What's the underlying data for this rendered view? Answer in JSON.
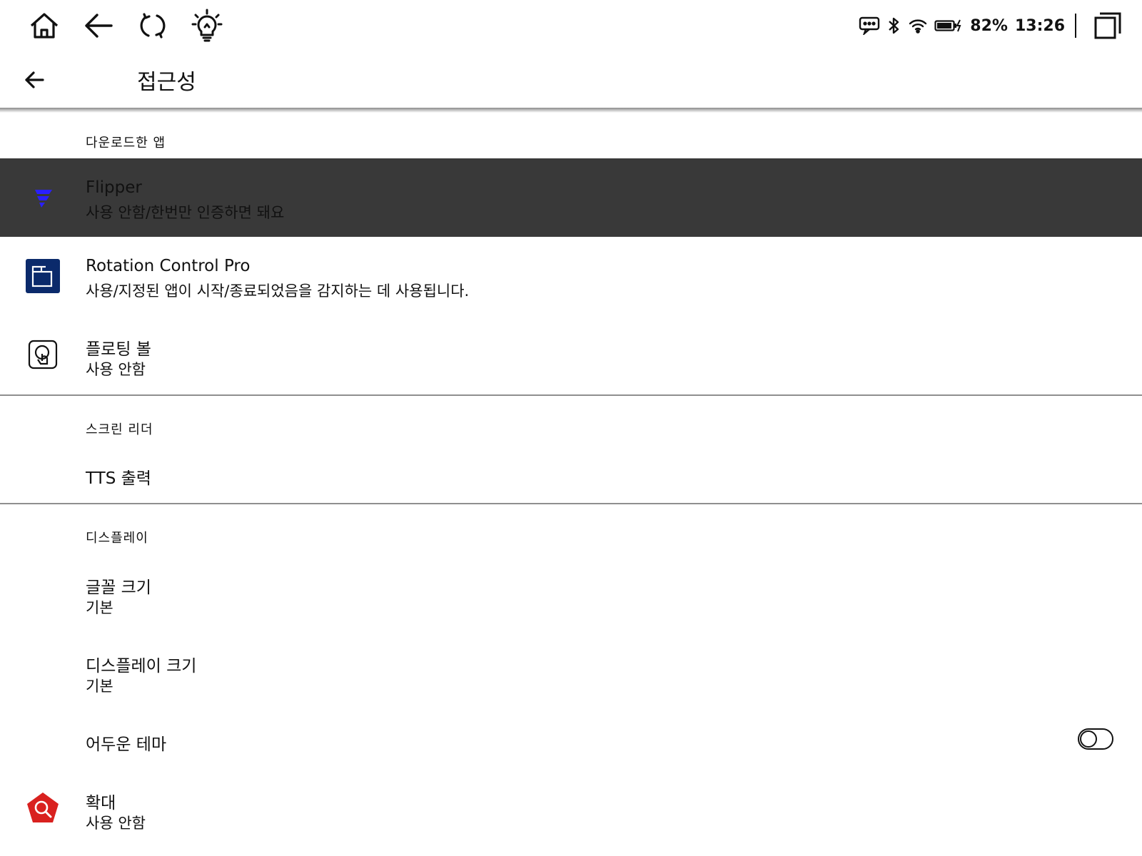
{
  "status": {
    "battery": "82%",
    "time": "13:26"
  },
  "header": {
    "title": "접근성"
  },
  "sections": {
    "downloaded": {
      "header": "다운로드한 앱",
      "items": [
        {
          "title": "Flipper",
          "subtitle": "사용 안함/한번만 인증하면 돼요"
        },
        {
          "title": "Rotation Control Pro",
          "subtitle": "사용/지정된 앱이 시작/종료되었음을 감지하는 데 사용됩니다."
        },
        {
          "title": "플로팅 볼",
          "subtitle": "사용 안함"
        }
      ]
    },
    "screen_reader": {
      "header": "스크린 리더",
      "items": [
        {
          "title": "TTS 출력"
        }
      ]
    },
    "display": {
      "header": "디스플레이",
      "items": [
        {
          "title": "글꼴 크기",
          "subtitle": "기본"
        },
        {
          "title": "디스플레이 크기",
          "subtitle": "기본"
        },
        {
          "title": "어두운 테마",
          "toggle": "off"
        },
        {
          "title": "확대",
          "subtitle": "사용 안함"
        }
      ]
    }
  },
  "colors": {
    "selected_row": "#393939",
    "flipper_icon": "#2a1fff",
    "rotation_icon": "#0b2a6b",
    "magnify_icon": "#d9211f"
  }
}
